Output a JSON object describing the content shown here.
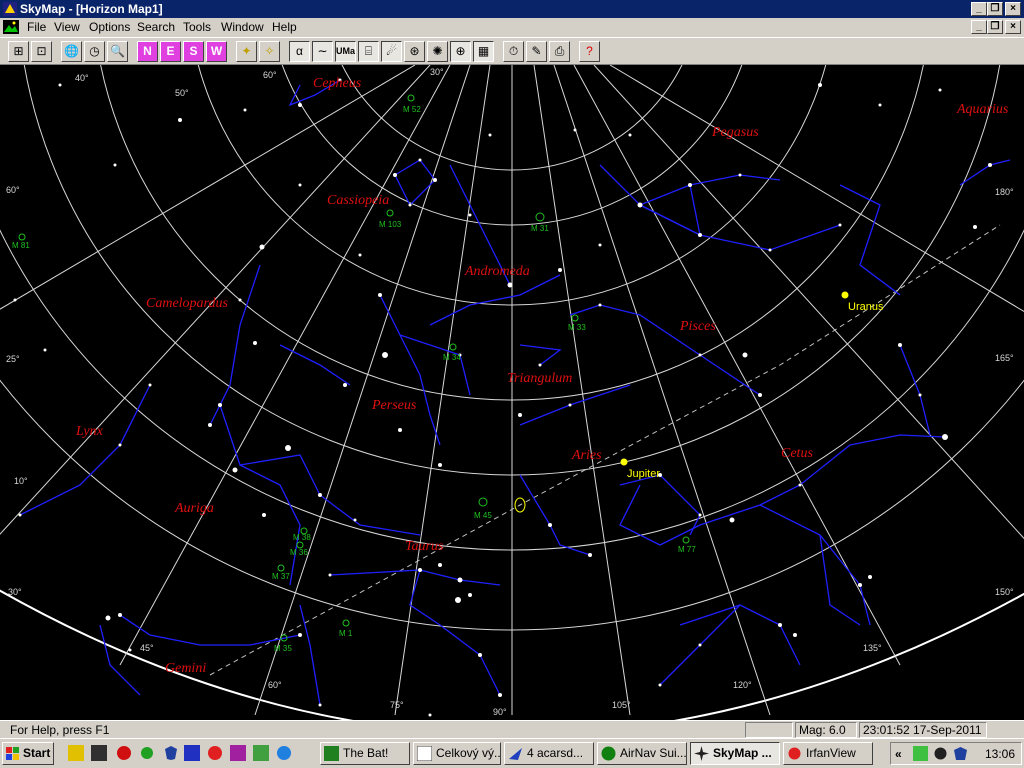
{
  "window": {
    "title": "SkyMap - [Horizon Map1]"
  },
  "menu": [
    {
      "label": "File"
    },
    {
      "label": "View"
    },
    {
      "label": "Options"
    },
    {
      "label": "Search"
    },
    {
      "label": "Tools"
    },
    {
      "label": "Window"
    },
    {
      "label": "Help"
    }
  ],
  "toolbar": {
    "dir_n": "N",
    "dir_e": "E",
    "dir_s": "S",
    "dir_w": "W",
    "alpha": "α",
    "uma": "UMa"
  },
  "map": {
    "constellations": [
      "Cepheus",
      "Cassiopeia",
      "Andromeda",
      "Camelopardus",
      "Pegasus",
      "Aquarius",
      "Pisces",
      "Triangulum",
      "Perseus",
      "Lynx",
      "Aries",
      "Cetus",
      "Auriga",
      "Taurus",
      "Gemini"
    ],
    "planets": [
      "Uranus",
      "Jupiter"
    ],
    "messier": [
      "M 52",
      "M 103",
      "M 31",
      "M 33",
      "M 34",
      "M 45",
      "M 1",
      "M 77",
      "M 36",
      "M 38",
      "M 37",
      "M 35",
      "M 81"
    ],
    "grid_labels": {
      "alt_30_top": "30°",
      "alt_40": "40°",
      "alt_50": "50°",
      "alt_60_top": "60°",
      "alt_60_left": "60°",
      "alt_25_left": "25°",
      "alt_10_left": "10°",
      "alt_30_left": "30°",
      "az_180": "180°",
      "az_165": "165°",
      "az_150": "150°",
      "az_135": "135°",
      "az_120": "120°",
      "az_105": "105°",
      "az_90": "90°",
      "az_75": "75°",
      "az_60": "60°",
      "az_45": "45°"
    },
    "colors": {
      "background": "#000000",
      "grid": "#d8d8d8",
      "lines": "#2020ff",
      "labels": "#e01010",
      "messier": "#20c020",
      "planet": "#ffff00"
    }
  },
  "status": {
    "help": "For Help, press F1",
    "mag": "Mag: 6.0",
    "datetime": "23:01:52 17-Sep-2011"
  },
  "taskbar": {
    "start": "Start",
    "tasks": [
      {
        "label": "The Bat!"
      },
      {
        "label": "Celkový vý..."
      },
      {
        "label": "4 acarsd..."
      },
      {
        "label": "AirNav Sui..."
      },
      {
        "label": "SkyMap ..."
      },
      {
        "label": "IrfanView"
      }
    ],
    "clock": "13:06"
  }
}
